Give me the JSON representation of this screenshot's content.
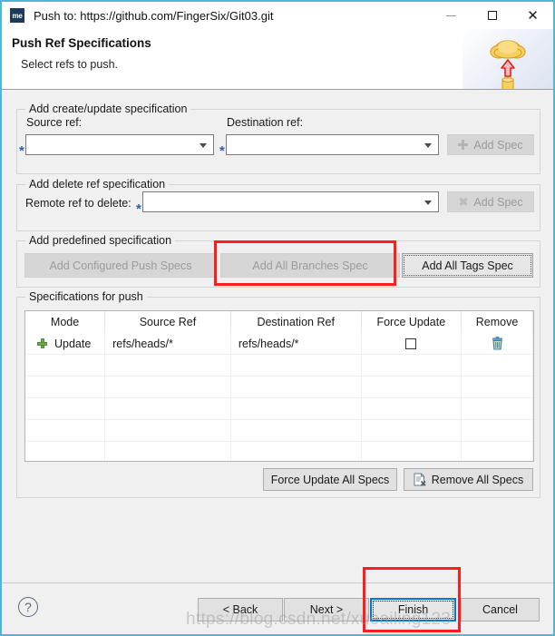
{
  "window": {
    "title": "Push to: https://github.com/FingerSix/Git03.git",
    "app_icon": "me-app-icon",
    "minimize_label": "Minimize",
    "maximize_label": "Maximize",
    "close_label": "Close",
    "border_color": "#4bb8d4"
  },
  "header": {
    "title": "Push Ref Specifications",
    "subtitle": "Select refs to push.",
    "artwork": "cloud-upload-graphic"
  },
  "create_update_group": {
    "title": "Add create/update specification",
    "source_label": "Source ref:",
    "source_value": "",
    "source_required": "*",
    "destination_label": "Destination ref:",
    "destination_value": "",
    "destination_required": "*",
    "add_spec_label": "Add Spec",
    "add_spec_enabled": false,
    "add_spec_icon": "plus-icon"
  },
  "delete_group": {
    "title": "Add delete ref specification",
    "remote_label": "Remote ref to delete:",
    "remote_value": "",
    "remote_required": "*",
    "add_spec_label": "Add Spec",
    "add_spec_enabled": false,
    "add_spec_icon": "x-icon"
  },
  "predefined_group": {
    "title": "Add predefined specification",
    "configured_push_specs_label": "Add Configured Push Specs",
    "configured_push_specs_enabled": false,
    "all_branches_label": "Add All Branches Spec",
    "all_branches_enabled": false,
    "all_tags_label": "Add All Tags Spec",
    "all_tags_enabled": true
  },
  "specs_group": {
    "title": "Specifications for push",
    "columns": [
      "Mode",
      "Source Ref",
      "Destination Ref",
      "Force Update",
      "Remove"
    ],
    "rows": [
      {
        "mode_icon": "plus-icon",
        "mode": "Update",
        "source_ref": "refs/heads/*",
        "destination_ref": "refs/heads/*",
        "force_update": false,
        "remove_icon": "trash-icon"
      }
    ],
    "empty_row_count": 6,
    "force_update_all_label": "Force Update All Specs",
    "remove_all_label": "Remove All Specs",
    "remove_all_icon": "document-remove-icon"
  },
  "footer": {
    "help_icon": "question-mark-icon",
    "back_label": "< Back",
    "next_label": "Next >",
    "finish_label": "Finish",
    "cancel_label": "Cancel",
    "default_button": "Finish"
  },
  "annotations": {
    "highlight_color": "#fb1e1e",
    "boxes": [
      "Add All Branches Spec",
      "Finish"
    ]
  },
  "watermark": {
    "text": "https://blog.csdn.net/xueailing123"
  }
}
